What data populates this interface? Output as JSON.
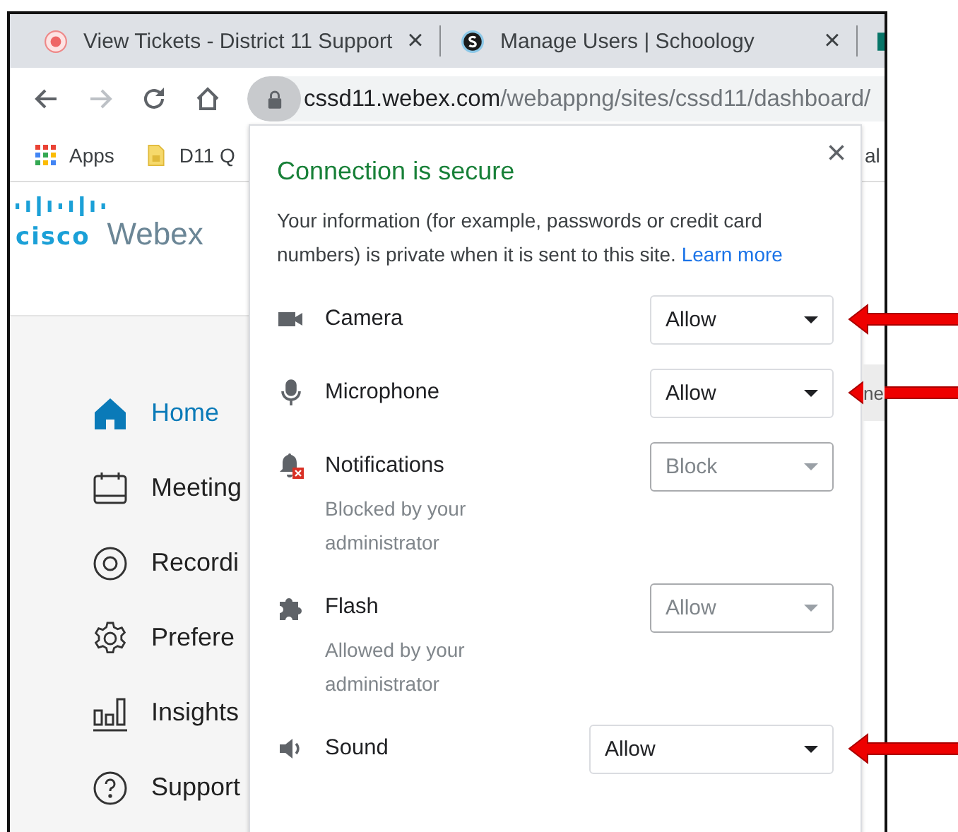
{
  "tabs": [
    {
      "title": "View Tickets - District 11 Support",
      "close": "×"
    },
    {
      "title": "Manage Users | Schoology",
      "close": "×"
    }
  ],
  "address": {
    "domain": "cssd11.webex.com",
    "path": "/webappng/sites/cssd11/dashboard/"
  },
  "bookmarks": [
    {
      "label": "Apps"
    },
    {
      "label": "D11 Q"
    }
  ],
  "bookmarks_right": "al",
  "logo": {
    "brand": "cisco",
    "product": "Webex"
  },
  "sidebar": {
    "items": [
      {
        "label": "Home",
        "selected": true
      },
      {
        "label": "Meeting",
        "selected": false
      },
      {
        "label": "Recordi",
        "selected": false
      },
      {
        "label": "Prefere",
        "selected": false
      },
      {
        "label": "Insights",
        "selected": false
      },
      {
        "label": "Support",
        "selected": false
      }
    ]
  },
  "page_tab": "ne",
  "popup": {
    "title": "Connection is secure",
    "description": "Your information (for example, passwords or credit card numbers) is private when it is sent to this site.",
    "link": "Learn more",
    "close": "×",
    "permissions": [
      {
        "name": "Camera",
        "value": "Allow",
        "disabled": false,
        "arrow": true
      },
      {
        "name": "Microphone",
        "value": "Allow",
        "disabled": false,
        "arrow": true
      },
      {
        "name": "Notifications",
        "value": "Block",
        "disabled": true,
        "note": "Blocked by your administrator",
        "arrow": false
      },
      {
        "name": "Flash",
        "value": "Allow",
        "disabled": true,
        "note": "Allowed by your administrator",
        "arrow": false
      },
      {
        "name": "Sound",
        "value": "Allow",
        "disabled": false,
        "wide": true,
        "arrow": true
      }
    ]
  }
}
